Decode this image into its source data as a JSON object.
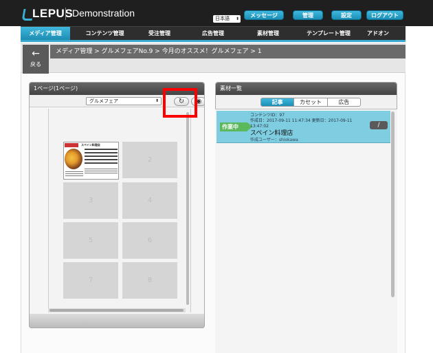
{
  "header": {
    "logo": "LEPUS",
    "app_title": "Demonstration",
    "language": "日本語",
    "buttons": [
      "メッセージ",
      "管理",
      "設定",
      "ログアウト"
    ]
  },
  "nav": {
    "items": [
      "メディア管理",
      "コンテンツ管理",
      "受注管理",
      "広告管理",
      "素材管理",
      "テンプレート管理",
      "アドオン"
    ],
    "active_index": 0
  },
  "breadcrumb": {
    "back_label": "戻る",
    "path": "メディア管理 > グルメフェアNo.9 > 今月のオススメ！グルメフェア > 1"
  },
  "left_panel": {
    "title": "1ページ(1ページ)",
    "media_select": "グルメフェア",
    "pages": [
      "1",
      "2",
      "3",
      "4",
      "5",
      "6",
      "7",
      "8"
    ],
    "thumbnail_title": "スペイン料理店"
  },
  "right_panel": {
    "title": "素材一覧",
    "tabs": [
      "記事",
      "カセット",
      "広告"
    ],
    "active_tab": 0,
    "item": {
      "status": "作業中",
      "meta_line1": "コンテンツID：97",
      "meta_line2": "作成日：2017-09-11 11:47:34 更新日：2017-09-11",
      "meta_line3": "13:47:02",
      "title": "スペイン料理店",
      "author": "作成ユーザー：shiokawa"
    }
  },
  "colors": {
    "accent": "#39a8cf",
    "header_bg": "#1f1f1f",
    "item_bg": "#7fcde0",
    "status_green": "#5cb85c",
    "highlight_red": "#ff0000"
  }
}
